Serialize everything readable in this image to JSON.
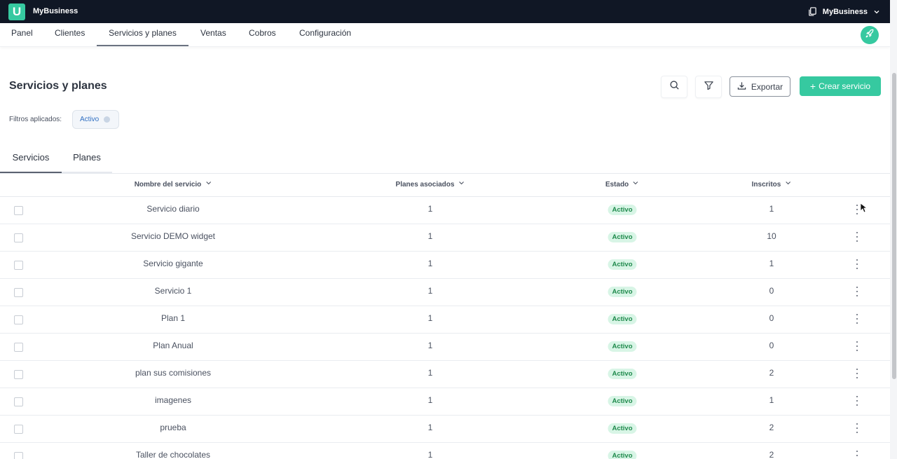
{
  "app": {
    "logo_letter": "U",
    "brand": "MyBusiness",
    "account_name": "MyBusiness",
    "accent_color": "#36c9a0"
  },
  "nav": {
    "items": [
      {
        "label": "Panel"
      },
      {
        "label": "Clientes"
      },
      {
        "label": "Servicios y planes",
        "active": true
      },
      {
        "label": "Ventas"
      },
      {
        "label": "Cobros"
      },
      {
        "label": "Configuración"
      }
    ]
  },
  "header": {
    "title": "Servicios y planes",
    "export_label": "Exportar",
    "create_label": "Crear servicio",
    "create_prefix": "+"
  },
  "filters": {
    "label": "Filtros aplicados:",
    "chips": [
      "Activo"
    ]
  },
  "tabs": [
    {
      "label": "Servicios",
      "active": true
    },
    {
      "label": "Planes",
      "active": false
    }
  ],
  "table": {
    "columns": [
      "Nombre del servicio",
      "Planes asociados",
      "Estado",
      "Inscritos"
    ],
    "rows": [
      {
        "name": "Servicio diario",
        "plans": "1",
        "status": "Activo",
        "enrolled": "1"
      },
      {
        "name": "Servicio DEMO widget",
        "plans": "1",
        "status": "Activo",
        "enrolled": "10"
      },
      {
        "name": "Servicio gigante",
        "plans": "1",
        "status": "Activo",
        "enrolled": "1"
      },
      {
        "name": "Servicio 1",
        "plans": "1",
        "status": "Activo",
        "enrolled": "0"
      },
      {
        "name": "Plan 1",
        "plans": "1",
        "status": "Activo",
        "enrolled": "0"
      },
      {
        "name": "Plan Anual",
        "plans": "1",
        "status": "Activo",
        "enrolled": "0"
      },
      {
        "name": "plan sus comisiones",
        "plans": "1",
        "status": "Activo",
        "enrolled": "2"
      },
      {
        "name": "imagenes",
        "plans": "1",
        "status": "Activo",
        "enrolled": "1"
      },
      {
        "name": "prueba",
        "plans": "1",
        "status": "Activo",
        "enrolled": "2"
      },
      {
        "name": "Taller de chocolates",
        "plans": "1",
        "status": "Activo",
        "enrolled": "2"
      }
    ]
  }
}
